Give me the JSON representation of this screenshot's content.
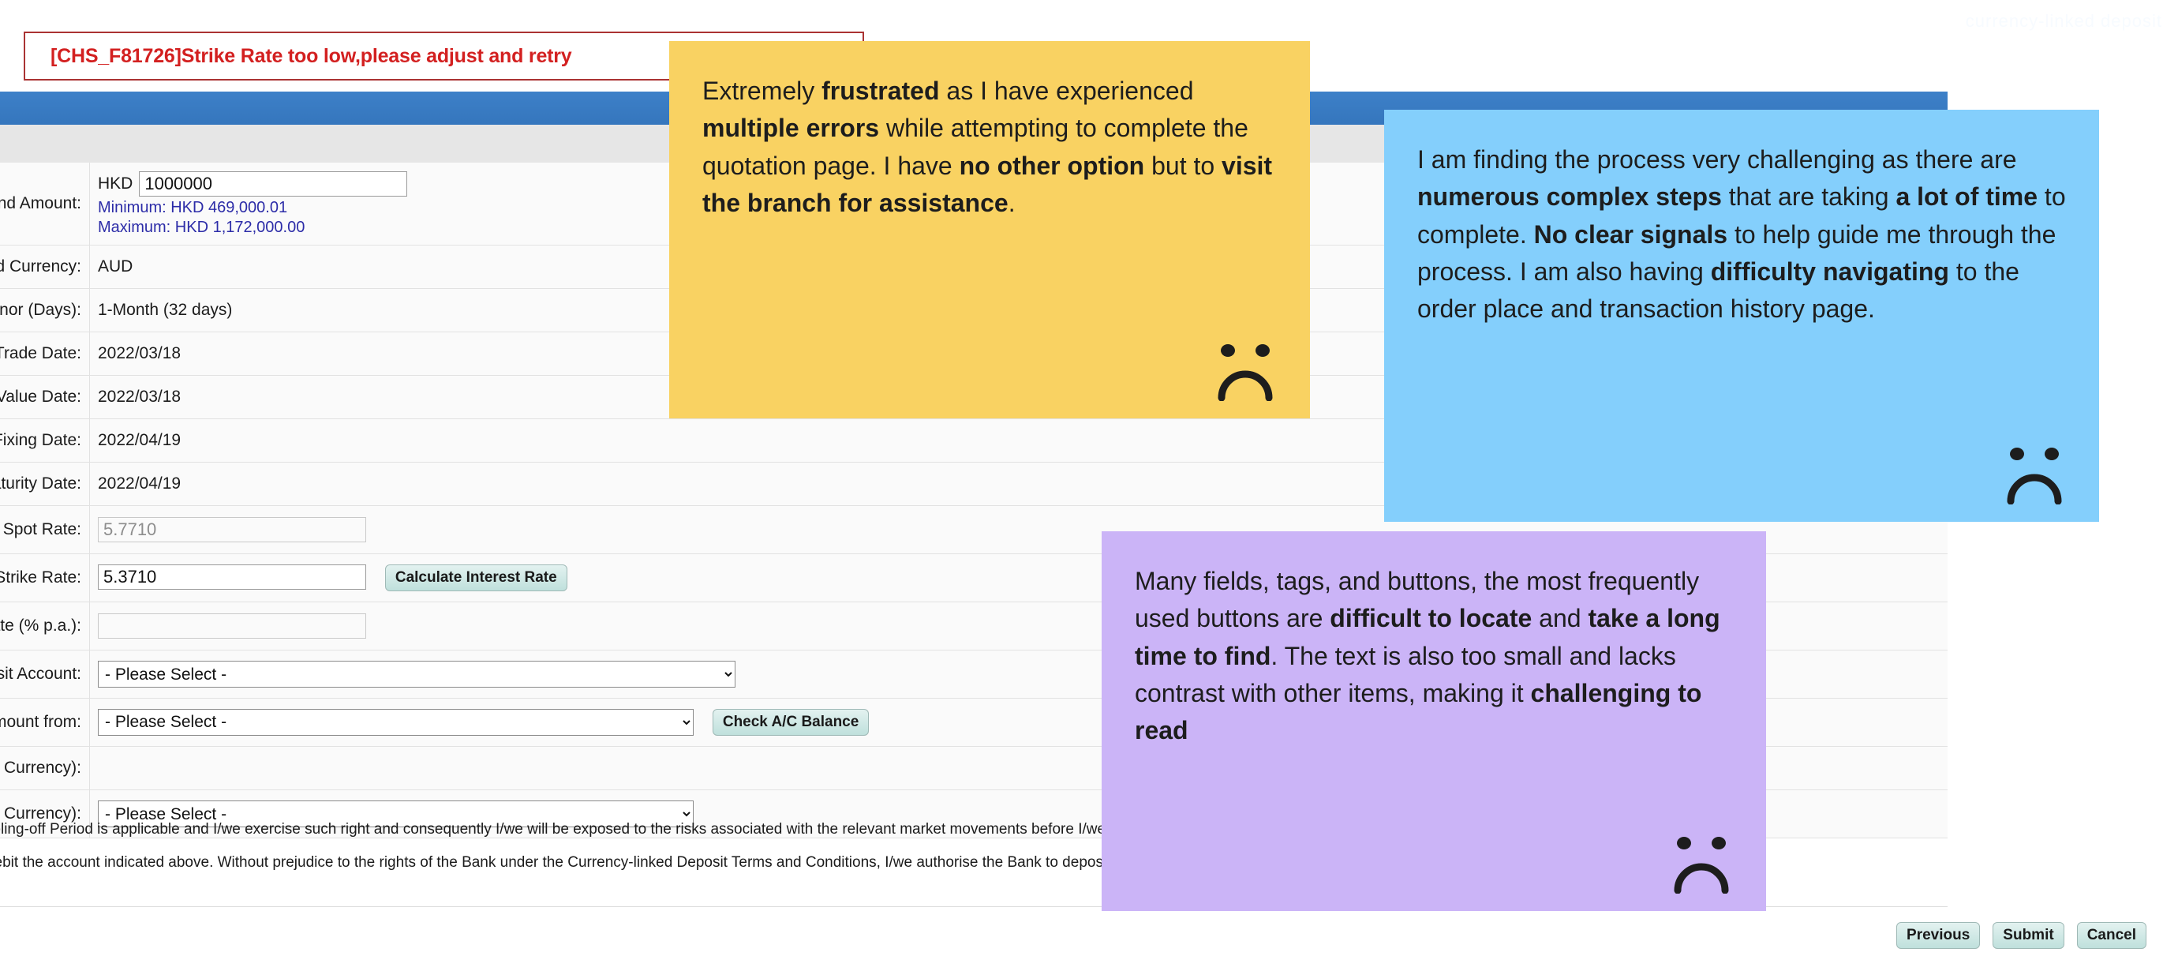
{
  "watermark": "currency-linked deposit",
  "error": {
    "message": "[CHS_F81726]Strike Rate too low,please adjust and retry"
  },
  "section": {
    "title": ""
  },
  "form": {
    "rows": [
      {
        "label": "Deposit Currency and Amount:",
        "currency": "HKD",
        "amount": "1000000",
        "minimum": "Minimum: HKD 469,000.01",
        "maximum": "Maximum: HKD 1,172,000.00"
      },
      {
        "label": "Linked Currency:",
        "value": "AUD"
      },
      {
        "label": "Deposit Tenor (Days):",
        "value": "1-Month (32 days)"
      },
      {
        "label": "Trade Date:",
        "value": "2022/03/18"
      },
      {
        "label": "Value Date:",
        "value": "2022/03/18"
      },
      {
        "label": "Exchange Rate Fixing Date:",
        "value": "2022/04/19"
      },
      {
        "label": "Maturity Date:",
        "value": "2022/04/19"
      },
      {
        "label": "Spot Rate:",
        "value": "5.7710"
      },
      {
        "label": "Strike Rate:",
        "value": "5.3710",
        "button": "Calculate Interest Rate"
      },
      {
        "label": "Interest Rate (% p.a.):",
        "value": ""
      },
      {
        "label": "Currency-linked Deposit Account:",
        "select": "- Please Select -"
      },
      {
        "label": "Debit Principal Amount from:",
        "select": "- Please Select -",
        "button": "Check A/C Balance"
      },
      {
        "label": "Credit Account (Deposit Currency):",
        "value": ""
      },
      {
        "label": "Credit Account (Linked Currency):",
        "select": "- Please Select -"
      }
    ]
  },
  "terms": {
    "line1": "I/we understand that the Cooling-off Period is applicable and I/we exercise such right and consequently I/we will be exposed to the risks associated with the relevant market movements before I/we place an order.",
    "line2": "I/we authorise the Bank to debit the account indicated above. Without prejudice to the rights of the Bank under the Currency-linked Deposit Terms and Conditions, I/we authorise the Bank to deposit the principal and interest into"
  },
  "footer": {
    "previous": "Previous",
    "submit": "Submit",
    "cancel": "Cancel"
  },
  "notes": {
    "yellow": {
      "color": "#f9d262",
      "segments": [
        {
          "text": "Extremely ",
          "bold": false
        },
        {
          "text": "frustrated",
          "bold": true
        },
        {
          "text": " as I have experienced ",
          "bold": false
        },
        {
          "text": "multiple errors",
          "bold": true
        },
        {
          "text": " while attempting to complete the quotation page. I have ",
          "bold": false
        },
        {
          "text": "no other option",
          "bold": true
        },
        {
          "text": " but to ",
          "bold": false
        },
        {
          "text": "visit the branch for assistance",
          "bold": true
        },
        {
          "text": ".",
          "bold": false
        }
      ]
    },
    "blue": {
      "color": "#84cffc",
      "segments": [
        {
          "text": "I am finding the process very challenging as there are ",
          "bold": false
        },
        {
          "text": "numerous complex steps",
          "bold": true
        },
        {
          "text": " that are taking ",
          "bold": false
        },
        {
          "text": "a lot of time",
          "bold": true
        },
        {
          "text": " to complete. ",
          "bold": false
        },
        {
          "text": "No clear signals",
          "bold": true
        },
        {
          "text": " to help guide me through the process. I am also having ",
          "bold": false
        },
        {
          "text": "difficulty navigating",
          "bold": true
        },
        {
          "text": " to the order place and transaction history page.",
          "bold": false
        }
      ]
    },
    "purple": {
      "color": "#cbb4f7",
      "segments": [
        {
          "text": "Many fields, tags, and buttons, the most frequently used buttons are ",
          "bold": false
        },
        {
          "text": "difficult to locate",
          "bold": true
        },
        {
          "text": " and ",
          "bold": false
        },
        {
          "text": "take a long time to find",
          "bold": true
        },
        {
          "text": ". The text is also too small and lacks contrast with other items, making it ",
          "bold": false
        },
        {
          "text": "challenging to read",
          "bold": true
        }
      ]
    }
  }
}
